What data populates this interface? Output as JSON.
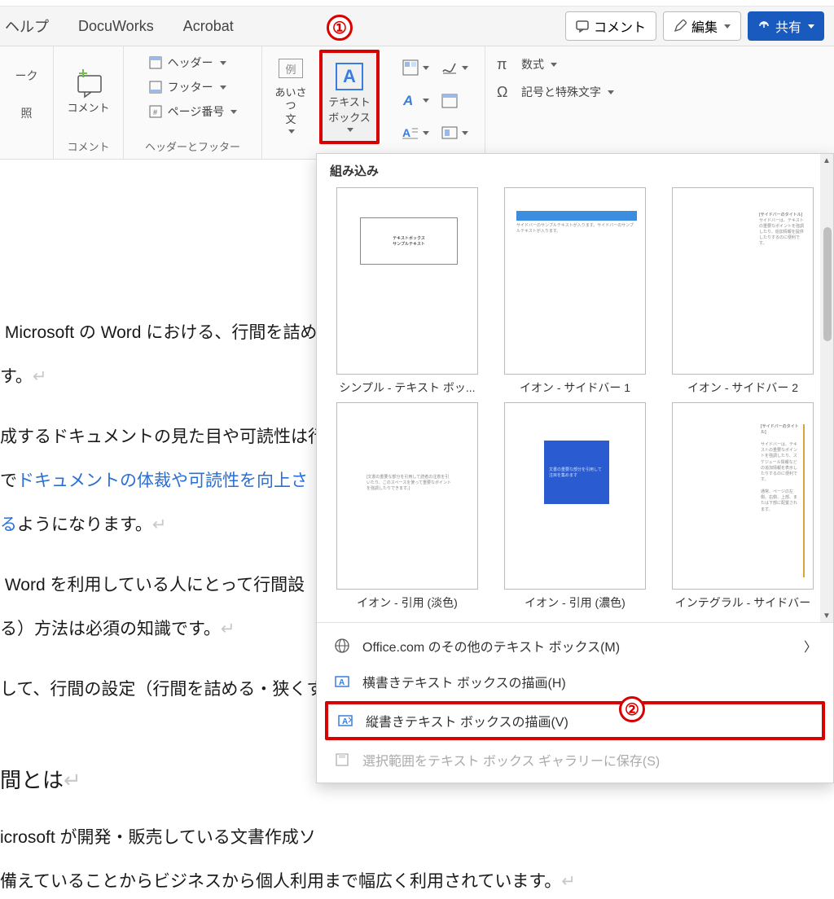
{
  "tabs": {
    "help": "ヘルプ",
    "docuworks": "DocuWorks",
    "acrobat": "Acrobat"
  },
  "top_buttons": {
    "comment": "コメント",
    "edit": "編集",
    "share": "共有"
  },
  "ribbon": {
    "mark_group": {
      "mark": "ーク",
      "照": "照",
      "comment": "コメント",
      "group_label": "コメント"
    },
    "header_group": {
      "header": "ヘッダー",
      "footer": "フッター",
      "page_number": "ページ番号",
      "group_label": "ヘッダーとフッター"
    },
    "greeting": "あいさつ\n文",
    "textbox": "テキスト\nボックス",
    "equation": "数式",
    "symbol": "記号と特殊文字"
  },
  "annot": {
    "one": "①",
    "two": "②"
  },
  "document": {
    "p1": "Microsoft の Word における、行間を詰め",
    "p1b": "す。",
    "p2": "成するドキュメントの見た目や可読性は行",
    "p3a": "で",
    "p3b": "ドキュメントの体裁や可読性を向上さ",
    "p4a": "る",
    "p4b": "ようになります。",
    "p5": "Word を利用している人にとって行間設",
    "p6": "る）方法は必須の知識です。",
    "p7": "して、行間の設定（行間を詰める・狭くす",
    "h": "間とは",
    "p8": "icrosoft が開発・販売している文書作成ソ",
    "p9": "備えていることからビジネスから個人利用まで幅広く利用されています。"
  },
  "dropdown": {
    "section": "組み込み",
    "items": [
      "シンプル - テキスト ボッ...",
      "イオン - サイドバー 1",
      "イオン - サイドバー 2",
      "イオン - 引用 (淡色)",
      "イオン - 引用 (濃色)",
      "インテグラル - サイドバー"
    ],
    "menu": {
      "office": "Office.com のその他のテキスト ボックス(M)",
      "horiz": "横書きテキスト ボックスの描画(H)",
      "vert": "縦書きテキスト ボックスの描画(V)",
      "save": "選択範囲をテキスト ボックス ギャラリーに保存(S)"
    }
  }
}
